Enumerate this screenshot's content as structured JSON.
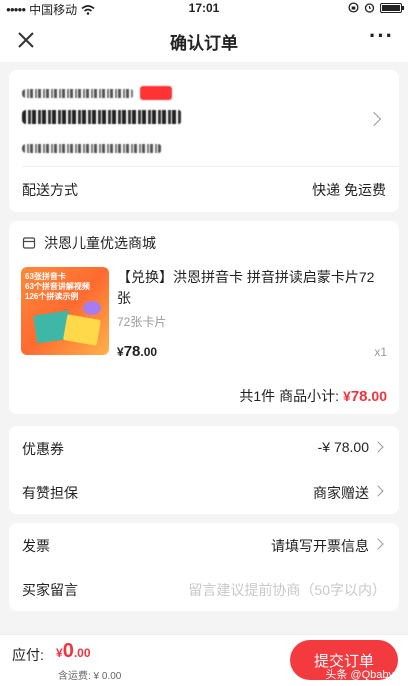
{
  "status": {
    "carrier": "中国移动",
    "time": "17:01"
  },
  "nav": {
    "title": "确认订单"
  },
  "shipping": {
    "label": "配送方式",
    "value": "快递 免运费"
  },
  "shop": {
    "name": "洪恩儿童优选商城",
    "product": {
      "title": "【兑换】洪恩拼音卡 拼音拼读启蒙卡片72张",
      "spec": "72张卡片",
      "price_symbol": "¥",
      "price": "78.00",
      "price_int": "78",
      "price_dec": ".00",
      "qty": "x1",
      "image_lines": [
        "63张拼音卡",
        "63个拼音讲解视频",
        "126个拼读示例"
      ]
    },
    "count_label": "共1件",
    "subtotal_label": "商品小计:",
    "subtotal_symbol": "¥",
    "subtotal_int": "78",
    "subtotal_dec": ".00"
  },
  "coupon": {
    "label": "优惠券",
    "value": "-¥ 78.00"
  },
  "guarantee": {
    "label": "有赞担保",
    "value": "商家赠送"
  },
  "invoice": {
    "label": "发票",
    "value": "请填写开票信息"
  },
  "message": {
    "label": "买家留言",
    "placeholder": "留言建议提前协商（50字以内）"
  },
  "bottom": {
    "pay_label": "应付:",
    "pay_symbol": "¥",
    "pay_int": "0",
    "pay_dec": ".00",
    "shipping_fee": "含运费: ¥ 0.00",
    "submit": "提交订单",
    "watermark": "头条 @Qbaby"
  },
  "colors": {
    "accent": "#f2333f",
    "button": "#f23a3f"
  }
}
